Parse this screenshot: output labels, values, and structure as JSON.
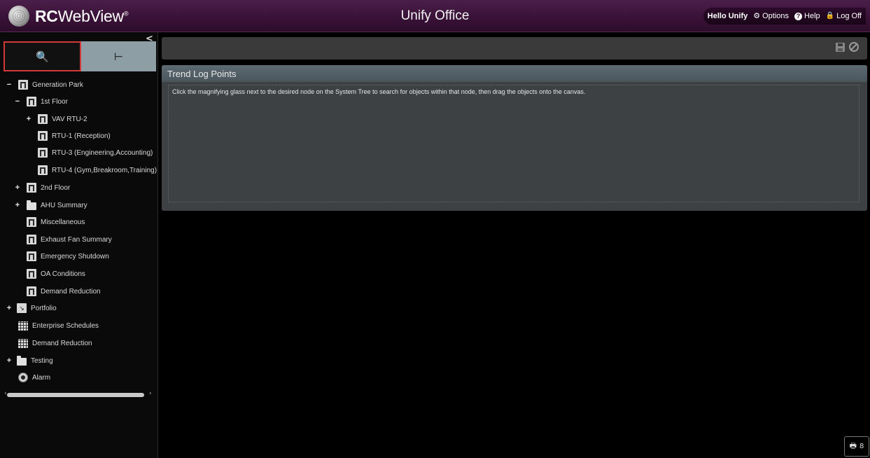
{
  "header": {
    "logo_bold": "RC",
    "logo_rest": "WebView",
    "logo_mark": "®",
    "title": "Unify Office",
    "greeting": "Hello Unify",
    "options_label": "Options",
    "help_label": "Help",
    "logoff_label": "Log Off"
  },
  "sidebar": {
    "collapse_glyph": "<",
    "tree": [
      {
        "label": "Generation Park",
        "expander": "−",
        "icon": "building-icon"
      },
      {
        "label": "1st Floor",
        "expander": "−",
        "icon": "building-icon"
      },
      {
        "label": "VAV RTU-2",
        "expander": "+",
        "icon": "building-icon"
      },
      {
        "label": "RTU-1 (Reception)",
        "expander": "",
        "icon": "building-icon"
      },
      {
        "label": "RTU-3 (Engineering,Accounting)",
        "expander": "",
        "icon": "building-icon"
      },
      {
        "label": "RTU-4 (Gym,Breakroom,Training)",
        "expander": "",
        "icon": "building-icon"
      },
      {
        "label": "2nd Floor",
        "expander": "+",
        "icon": "building-icon"
      },
      {
        "label": "AHU Summary",
        "expander": "+",
        "icon": "folder-icon"
      },
      {
        "label": "Miscellaneous",
        "expander": "",
        "icon": "building-icon"
      },
      {
        "label": "Exhaust Fan Summary",
        "expander": "",
        "icon": "building-icon"
      },
      {
        "label": "Emergency Shutdown",
        "expander": "",
        "icon": "building-icon"
      },
      {
        "label": "OA Conditions",
        "expander": "",
        "icon": "building-icon"
      },
      {
        "label": "Demand Reduction",
        "expander": "",
        "icon": "building-icon"
      },
      {
        "label": "Portfolio",
        "expander": "+",
        "icon": "portfolio-icon"
      },
      {
        "label": "Enterprise Schedules",
        "expander": "",
        "icon": "calendar-icon"
      },
      {
        "label": "Demand Reduction",
        "expander": "",
        "icon": "calendar-icon"
      },
      {
        "label": "Testing",
        "expander": "+",
        "icon": "folder-icon"
      },
      {
        "label": "Alarm",
        "expander": "",
        "icon": "alarm-icon"
      }
    ]
  },
  "main": {
    "panel_title": "Trend Log Points",
    "panel_message": "Click the magnifying glass next to the desired node on the System Tree to search for objects within that node, then drag the objects onto the canvas.",
    "corner_count": "8"
  }
}
